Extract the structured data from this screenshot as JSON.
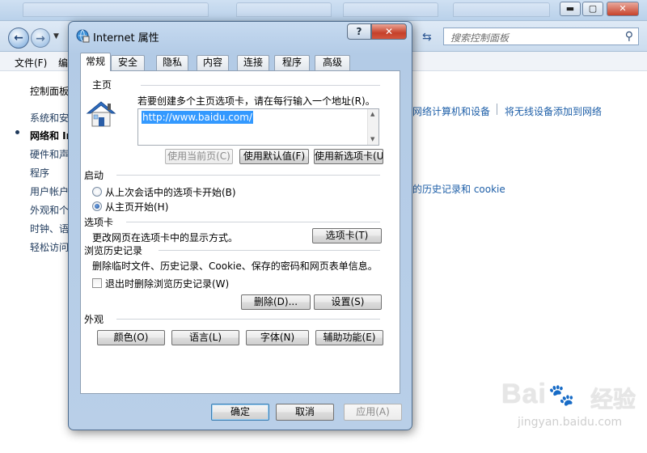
{
  "background": {
    "search_placeholder": "搜索控制面板",
    "menu": [
      "文件(F)",
      "编"
    ],
    "sidebar": [
      "控制面板",
      "系统和安",
      "网络和 In",
      "硬件和声",
      "程序",
      "用户帐户",
      "外观和个",
      "时钟、语",
      "轻松访问"
    ],
    "main_links": {
      "link_devices": "网络计算机和设备",
      "link_wireless": "将无线设备添加到网络",
      "link_history": "的历史记录和 cookie"
    },
    "watermark": {
      "brand": "Bai",
      "paw": "🐾",
      "cn": "经验",
      "domain": "jingyan.baidu.com"
    },
    "window_buttons": {
      "minimize": "▬",
      "maximize": "▢",
      "close": "✕"
    }
  },
  "dialog": {
    "title": "Internet 属性",
    "help_btn": "?",
    "close_btn": "✕",
    "tabs": [
      "常规",
      "安全",
      "隐私",
      "内容",
      "连接",
      "程序",
      "高级"
    ],
    "home": {
      "section": "主页",
      "instructions": "若要创建多个主页选项卡，请在每行输入一个地址(R)。",
      "url": "http://www.baidu.com/",
      "use_current": "使用当前页(C)",
      "use_default": "使用默认值(F)",
      "use_new_tab": "使用新选项卡(U)"
    },
    "startup": {
      "section": "启动",
      "option1": "从上次会话中的选项卡开始(B)",
      "option2": "从主页开始(H)"
    },
    "tabs_section": {
      "section": "选项卡",
      "description": "更改网页在选项卡中的显示方式。",
      "button": "选项卡(T)"
    },
    "history": {
      "section": "浏览历史记录",
      "description": "删除临时文件、历史记录、Cookie、保存的密码和网页表单信息。",
      "checkbox": "退出时删除浏览历史记录(W)",
      "delete_btn": "删除(D)...",
      "settings_btn": "设置(S)"
    },
    "appearance": {
      "section": "外观",
      "colors": "颜色(O)",
      "languages": "语言(L)",
      "fonts": "字体(N)",
      "accessibility": "辅助功能(E)"
    },
    "footer": {
      "ok": "确定",
      "cancel": "取消",
      "apply": "应用(A)"
    }
  }
}
